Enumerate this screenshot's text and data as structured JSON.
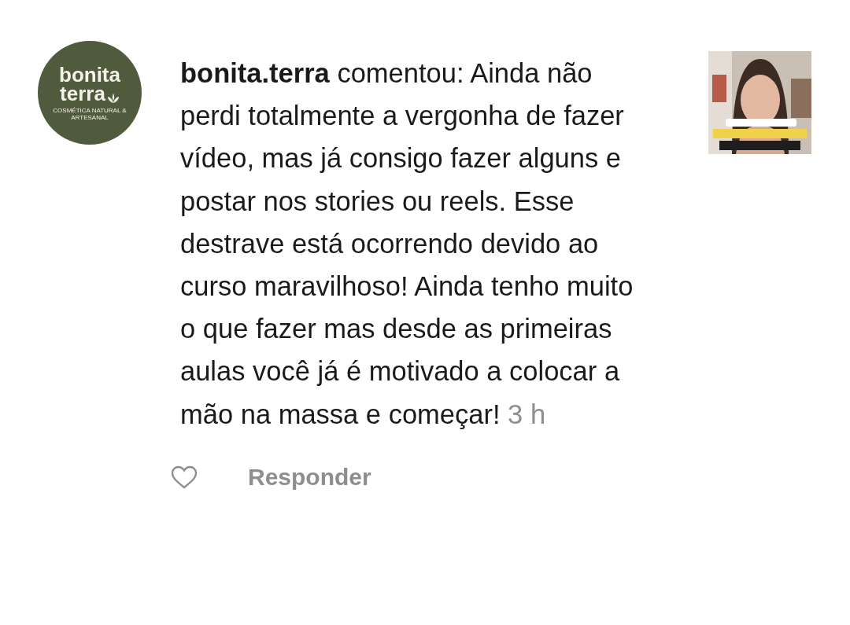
{
  "comment": {
    "avatar": {
      "logo_line_1": "bonita",
      "logo_line_2": "terra",
      "logo_tagline": "COSMÉTICA NATURAL & ARTESANAL"
    },
    "text": "**bonita.terra** comentou: Ainda não perdi totalmente a vergonha de fazer vídeo, mas já consigo fazer alguns e postar nos stories ou reels. Esse destrave está ocorrendo devido ao curso maravilhoso! Ainda tenho muito o que fazer mas desde as primeiras aulas você já é motivado a colocar a mão na massa e começar!",
    "time": "3 h",
    "liked": false,
    "reply_label": "Responder"
  }
}
